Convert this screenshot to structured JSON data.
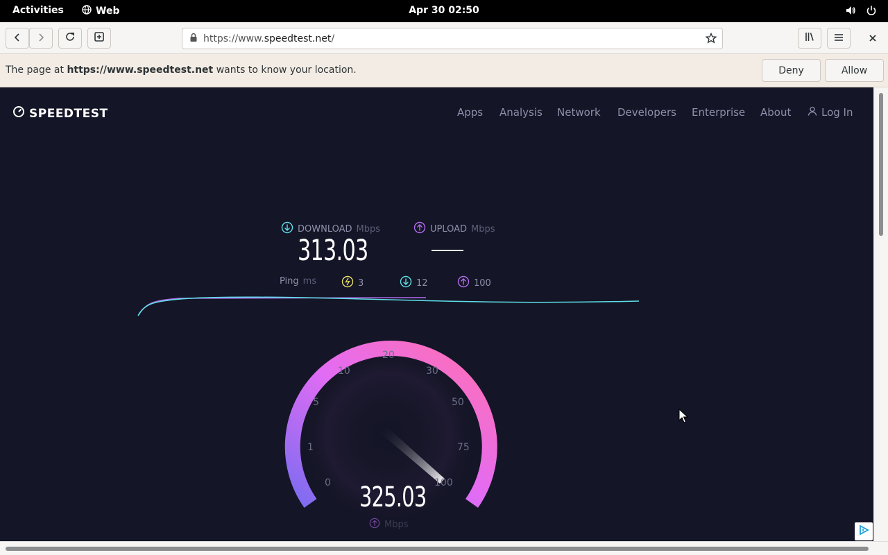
{
  "topbar": {
    "activities": "Activities",
    "app_name": "Web",
    "clock": "Apr 30  02:50",
    "icons": [
      "globe-icon",
      "volume-icon",
      "power-icon"
    ]
  },
  "browser": {
    "url_prefix": "https://www.",
    "url_host": "speedtest.net",
    "url_suffix": "/",
    "buttons": [
      "back-icon",
      "forward-icon",
      "reload-icon",
      "new-tab-icon",
      "star-icon",
      "library-icon",
      "menu-icon",
      "close-icon"
    ]
  },
  "permission": {
    "text_before": "The page at ",
    "site": "https://www.speedtest.net",
    "text_after": " wants to know your location.",
    "deny": "Deny",
    "allow": "Allow"
  },
  "site": {
    "logo": "SPEEDTEST",
    "nav": [
      "Apps",
      "Analysis",
      "Network",
      "Developers",
      "Enterprise",
      "About"
    ],
    "login": "Log In"
  },
  "results": {
    "download_label": "DOWNLOAD",
    "download_unit": "Mbps",
    "download_value": "313.03",
    "upload_label": "UPLOAD",
    "upload_unit": "Mbps",
    "ping_label": "Ping",
    "ping_unit": "ms",
    "ping_idle": "3",
    "ping_down": "12",
    "ping_up": "100"
  },
  "gauge": {
    "ticks": [
      "0",
      "1",
      "5",
      "10",
      "20",
      "30",
      "50",
      "75",
      "100"
    ],
    "current_speed": "325.03",
    "current_unit": "Mbps",
    "colors": {
      "start": "#7b6cf0",
      "mid": "#e36cf4",
      "end": "#ff6fb0",
      "download": "#5ee0e8",
      "upload": "#b46cf0",
      "ping": "#e8e26c"
    }
  }
}
